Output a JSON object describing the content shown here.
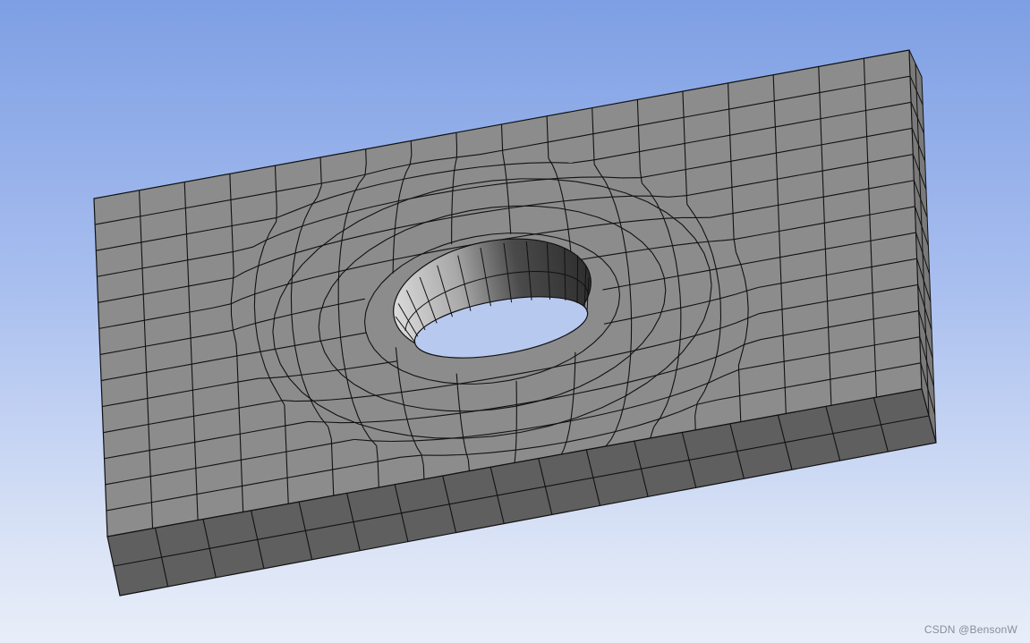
{
  "viewport": {
    "background_top": "#7e9fe4",
    "background_bottom": "#e8eef9"
  },
  "model": {
    "top_face_color": "#8c8c8c",
    "front_face_color": "#5f5f5f",
    "side_face_color": "#7a7a7a",
    "hole_wall_light": "#c4c4c4",
    "hole_wall_dark": "#3a3a3a",
    "edge_color": "#111111"
  },
  "watermark": {
    "text": "CSDN @BensonW"
  }
}
